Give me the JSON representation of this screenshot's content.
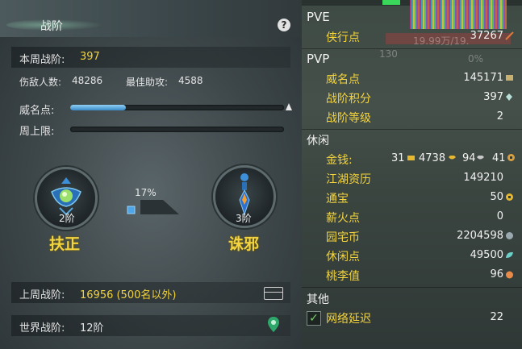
{
  "left": {
    "title": "战阶",
    "help": "?",
    "weekly_rank_label": "本周战阶:",
    "weekly_rank_value": "397",
    "enemies_hurt_label": "伤敌人数:",
    "enemies_hurt_value": "48286",
    "best_assist_label": "最佳助攻:",
    "best_assist_value": "4588",
    "prestige_label": "威名点:",
    "prestige_progress": 0.26,
    "weekly_cap_label": "周上限:",
    "weekly_cap_progress": 0,
    "faction_left": {
      "level": "2阶",
      "name": "扶正"
    },
    "faction_right": {
      "level": "3阶",
      "name": "诛邪"
    },
    "balance_percent": "17%",
    "balance_progress": 0.17,
    "last_week_label": "上周战阶:",
    "last_week_value": "16956 (500名以外)",
    "world_rank_label": "世界战阶:",
    "world_rank_value": "12阶"
  },
  "right": {
    "bg_text_1": "19.99万/19.",
    "bg_text_2": "130",
    "bg_text_3": "0%",
    "pve": {
      "title": "PVE",
      "items": [
        {
          "label": "侠行点",
          "value": "37267",
          "icon": "sword-icon"
        }
      ]
    },
    "pvp": {
      "title": "PVP",
      "items": [
        {
          "label": "威名点",
          "value": "145171",
          "icon": "badge-icon"
        },
        {
          "label": "战阶积分",
          "value": "397",
          "icon": "wing-icon"
        },
        {
          "label": "战阶等级",
          "value": "2",
          "icon": ""
        }
      ]
    },
    "leisure": {
      "title": "休闲",
      "money_label": "金钱:",
      "money": [
        {
          "value": "31",
          "icon": "gold-ingot-icon"
        },
        {
          "value": "4738",
          "icon": "gold-ingot-icon"
        },
        {
          "value": "94",
          "icon": "silver-ingot-icon"
        },
        {
          "value": "41",
          "icon": "copper-coin-icon"
        }
      ],
      "items": [
        {
          "label": "江湖资历",
          "value": "149210",
          "icon": ""
        },
        {
          "label": "通宝",
          "value": "50",
          "icon": "coin-icon"
        },
        {
          "label": "薪火点",
          "value": "0",
          "icon": ""
        },
        {
          "label": "园宅币",
          "value": "2204598",
          "icon": "house-coin-icon"
        },
        {
          "label": "休闲点",
          "value": "49500",
          "icon": "leaf-icon"
        },
        {
          "label": "桃李值",
          "value": "96",
          "icon": "peach-icon"
        }
      ]
    },
    "other": {
      "title": "其他",
      "items": [
        {
          "label": "网络延迟",
          "value": "22",
          "checked": true
        }
      ]
    }
  },
  "colors": {
    "accent_yellow": "#f2d43a",
    "bar_blue": "#3a8ac8",
    "panel_dark": "#2c3437"
  }
}
